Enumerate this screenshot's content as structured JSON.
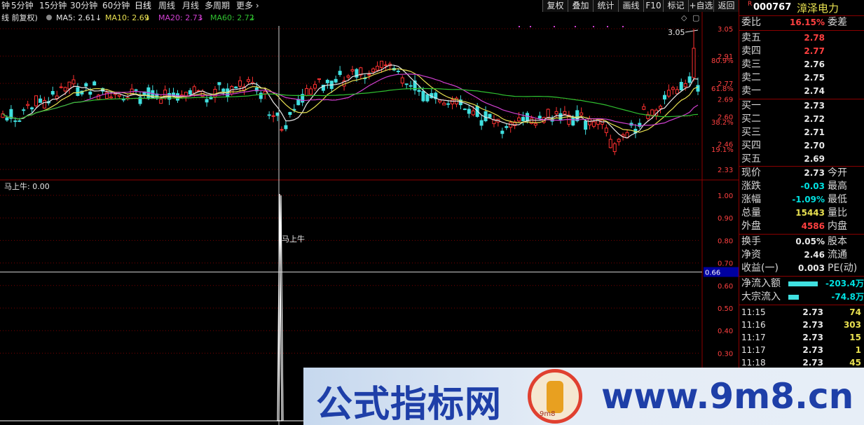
{
  "toolbar": {
    "periods": [
      "钟",
      "5分钟",
      "15分钟",
      "30分钟",
      "60分钟",
      "日线",
      "周线",
      "月线",
      "多周期",
      "更多"
    ],
    "active_period": "日线",
    "buttons": [
      "复权",
      "叠加",
      "统计",
      "画线",
      "F10",
      "标记",
      "+自选",
      "返回"
    ]
  },
  "main_panel": {
    "legend_prefix": "线 前复权)",
    "ma": [
      {
        "label": "MA5: 2.61",
        "color": "#e8e8e8"
      },
      {
        "label": "MA10: 2.69",
        "color": "#e8e050"
      },
      {
        "label": "MA20: 2.73",
        "color": "#d040d0"
      },
      {
        "label": "MA60: 2.72",
        "color": "#30c030"
      }
    ],
    "y_ticks": [
      "3.05",
      "2.91",
      "2.77",
      "2.69",
      "2.60",
      "2.46",
      "2.33"
    ],
    "fib_labels": [
      "80.9%",
      "61.8%",
      "38.2%",
      "19.1%"
    ],
    "high_marker": "3.05",
    "candle_colors": {
      "up": "#ff3030",
      "down": "#40e0e0"
    }
  },
  "sub_panel": {
    "title": "马上牛: 0.00",
    "signal_label": "马上牛",
    "y_ticks": [
      "1.00",
      "0.90",
      "0.80",
      "0.70",
      "0.60",
      "0.50",
      "0.40",
      "0.30"
    ],
    "crosshair_value": "0.66"
  },
  "stock": {
    "code": "000767",
    "name": "漳泽电力",
    "badge": "R"
  },
  "quote": {
    "weibi_label": "委比",
    "weibi_value": "16.15%",
    "weicha_label": "委差",
    "asks": [
      {
        "label": "卖五",
        "price": "2.78"
      },
      {
        "label": "卖四",
        "price": "2.77"
      },
      {
        "label": "卖三",
        "price": "2.76"
      },
      {
        "label": "卖二",
        "price": "2.75"
      },
      {
        "label": "卖一",
        "price": "2.74"
      }
    ],
    "bids": [
      {
        "label": "买一",
        "price": "2.73"
      },
      {
        "label": "买二",
        "price": "2.72"
      },
      {
        "label": "买三",
        "price": "2.71"
      },
      {
        "label": "买四",
        "price": "2.70"
      },
      {
        "label": "买五",
        "price": "2.69"
      }
    ],
    "stats": [
      {
        "l1": "现价",
        "v1": "2.73",
        "l2": "今开"
      },
      {
        "l1": "涨跌",
        "v1": "-0.03",
        "l2": "最高"
      },
      {
        "l1": "涨幅",
        "v1": "-1.09%",
        "l2": "最低"
      },
      {
        "l1": "总量",
        "v1": "15443",
        "l2": "量比"
      },
      {
        "l1": "外盘",
        "v1": "4586",
        "l2": "内盘"
      }
    ],
    "stats2": [
      {
        "l1": "换手",
        "v1": "0.05%",
        "l2": "股本"
      },
      {
        "l1": "净资",
        "v1": "2.46",
        "l2": "流通"
      },
      {
        "l1": "收益(一)",
        "v1": "0.003",
        "l2": "PE(动)"
      }
    ],
    "flows": [
      {
        "label": "净流入额",
        "value": "-203.4万",
        "bar": 0.95
      },
      {
        "label": "大宗流入",
        "value": "-74.8万",
        "bar": 0.35
      }
    ],
    "ticks": [
      {
        "time": "11:15",
        "price": "2.73",
        "vol": "74"
      },
      {
        "time": "11:16",
        "price": "2.73",
        "vol": "303"
      },
      {
        "time": "11:17",
        "price": "2.73",
        "vol": "15"
      },
      {
        "time": "11:17",
        "price": "2.73",
        "vol": "1"
      },
      {
        "time": "11:18",
        "price": "2.73",
        "vol": "45"
      }
    ]
  },
  "watermark": {
    "title": "公式指标网",
    "url": "www.9m8.cn",
    "logo_text": "9m8"
  }
}
